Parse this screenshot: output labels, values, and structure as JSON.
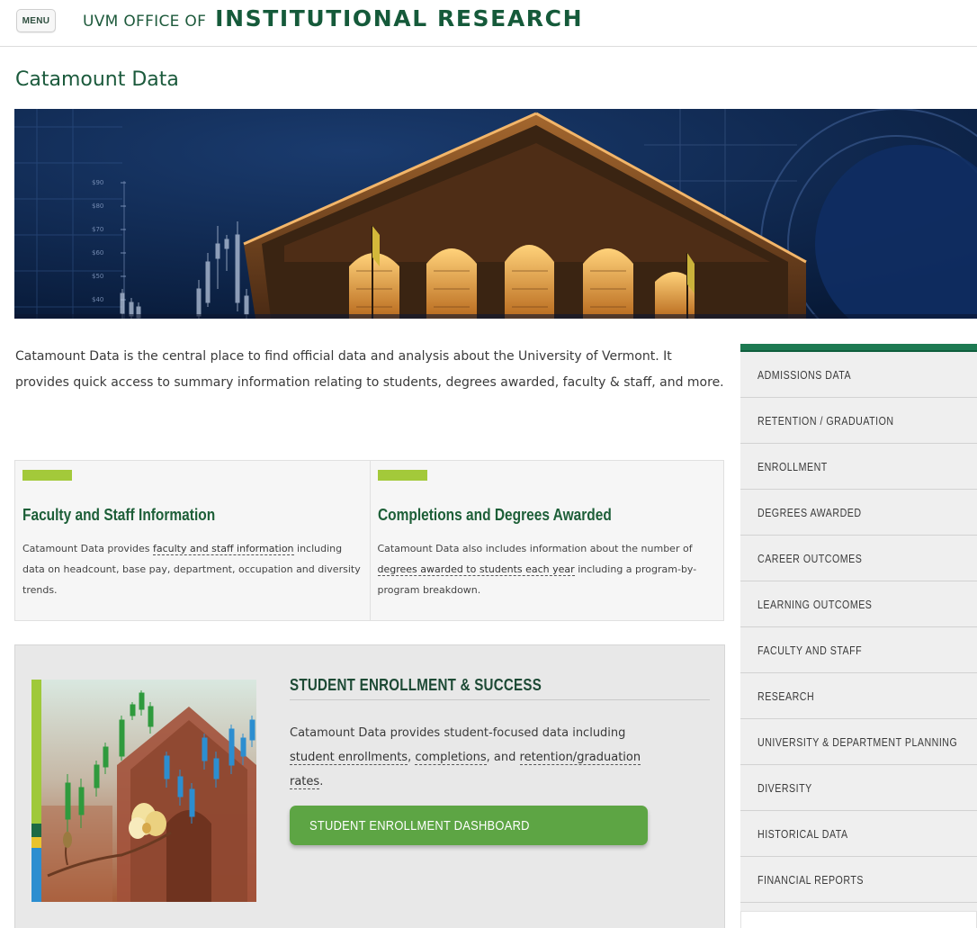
{
  "header": {
    "menu_label": "MENU",
    "brand_prefix": "UVM OFFICE OF",
    "brand_main": "INSTITUTIONAL RESEARCH"
  },
  "page_title": "Catamount Data",
  "hero": {
    "chart_ticks": [
      "$90",
      "$80",
      "$70",
      "$60",
      "$50",
      "$40"
    ]
  },
  "intro": "Catamount Data is the central place to find official data and analysis about the University of Vermont. It provides quick access to summary information relating to students, degrees awarded, faculty & staff, and more.",
  "features": [
    {
      "title": "Faculty and Staff Information",
      "text_before": "Catamount Data provides ",
      "link": "faculty and staff information",
      "text_after": " including data on headcount, base pay, department, occupation and diversity trends."
    },
    {
      "title": "Completions and Degrees Awarded",
      "text_before": "Catamount Data also includes information about the number of ",
      "link": "degrees awarded to students each year",
      "text_after": " including a program-by-program breakdown."
    }
  ],
  "enrollment": {
    "title": "STUDENT ENROLLMENT & SUCCESS",
    "text_before": "Catamount Data provides student-focused data including ",
    "link1": "student enrollments",
    "sep1": ", ",
    "link2": "completions",
    "sep2": ", and ",
    "link3": "retention/graduation rates",
    "text_after": ".",
    "button_label": "STUDENT ENROLLMENT DASHBOARD"
  },
  "sidebar": {
    "items": [
      {
        "label": "ADMISSIONS DATA"
      },
      {
        "label": "RETENTION / GRADUATION"
      },
      {
        "label": "ENROLLMENT"
      },
      {
        "label": "DEGREES AWARDED"
      },
      {
        "label": "CAREER OUTCOMES"
      },
      {
        "label": "LEARNING OUTCOMES"
      },
      {
        "label": "FACULTY AND STAFF"
      },
      {
        "label": "RESEARCH"
      },
      {
        "label": "UNIVERSITY & DEPARTMENT PLANNING"
      },
      {
        "label": "DIVERSITY"
      },
      {
        "label": "HISTORICAL DATA"
      },
      {
        "label": "FINANCIAL REPORTS"
      }
    ]
  },
  "colors": {
    "brand_green": "#155a3a",
    "accent_lime": "#a3c93a",
    "button_green": "#5da544",
    "sidebar_bar": "#1d7a52"
  }
}
